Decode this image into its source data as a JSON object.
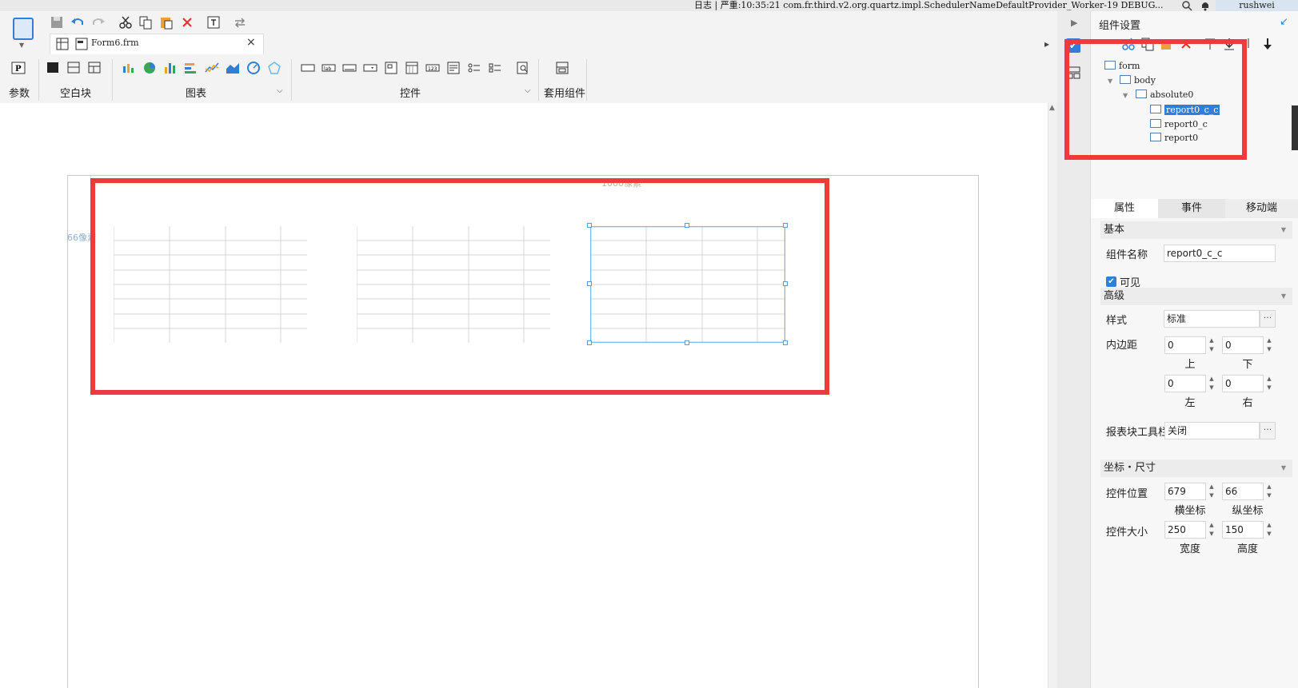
{
  "status_bar": {
    "log_text": "日志 | 严重:10:35:21 com.fr.third.v2.org.quartz.impl.SchedulerNameDefaultProvider_Worker-19 DEBUG...",
    "user": "rushwei"
  },
  "editor": {
    "tab_title": "Form6.frm",
    "tab_close": "×"
  },
  "ribbon": {
    "groups": [
      {
        "label": "参数"
      },
      {
        "label": "空白块"
      },
      {
        "label": "图表"
      },
      {
        "label": "控件"
      },
      {
        "label": "套用组件"
      }
    ],
    "dropdown_arrow": "⌵"
  },
  "canvas": {
    "width_label": "1000像素",
    "y_label": "66像素"
  },
  "panel": {
    "title": "组件设置",
    "tree": [
      {
        "label": "form",
        "level": 0
      },
      {
        "label": "body",
        "level": 1
      },
      {
        "label": "absolute0",
        "level": 2
      },
      {
        "label": "report0_c_c",
        "level": 3,
        "selected": true
      },
      {
        "label": "report0_c",
        "level": 3
      },
      {
        "label": "report0",
        "level": 3
      }
    ],
    "tabs": [
      "属性",
      "事件",
      "移动端"
    ],
    "sections": {
      "basic": "基本",
      "advanced": "高级",
      "geometry": "坐标・尺寸"
    },
    "fields": {
      "component_name_label": "组件名称",
      "component_name": "report0_c_c",
      "visible_label": "可见",
      "visible": true,
      "style_label": "样式",
      "style_value": "标准",
      "padding_label": "内边距",
      "padding_top": "0",
      "padding_bottom": "0",
      "padding_left": "0",
      "padding_right": "0",
      "top_label": "上",
      "bottom_label": "下",
      "left_label": "左",
      "right_label": "右",
      "toolbar_label": "报表块工具栏",
      "toolbar_value": "关闭",
      "position_label": "控件位置",
      "pos_x": "679",
      "pos_y": "66",
      "x_label": "横坐标",
      "y_label": "纵坐标",
      "size_label": "控件大小",
      "width": "250",
      "height": "150",
      "width_label": "宽度",
      "height_label": "高度"
    }
  },
  "colors": {
    "accent": "#2f7fd6",
    "highlight_box": "#f0393c",
    "selection_border": "#5b9bd5"
  }
}
